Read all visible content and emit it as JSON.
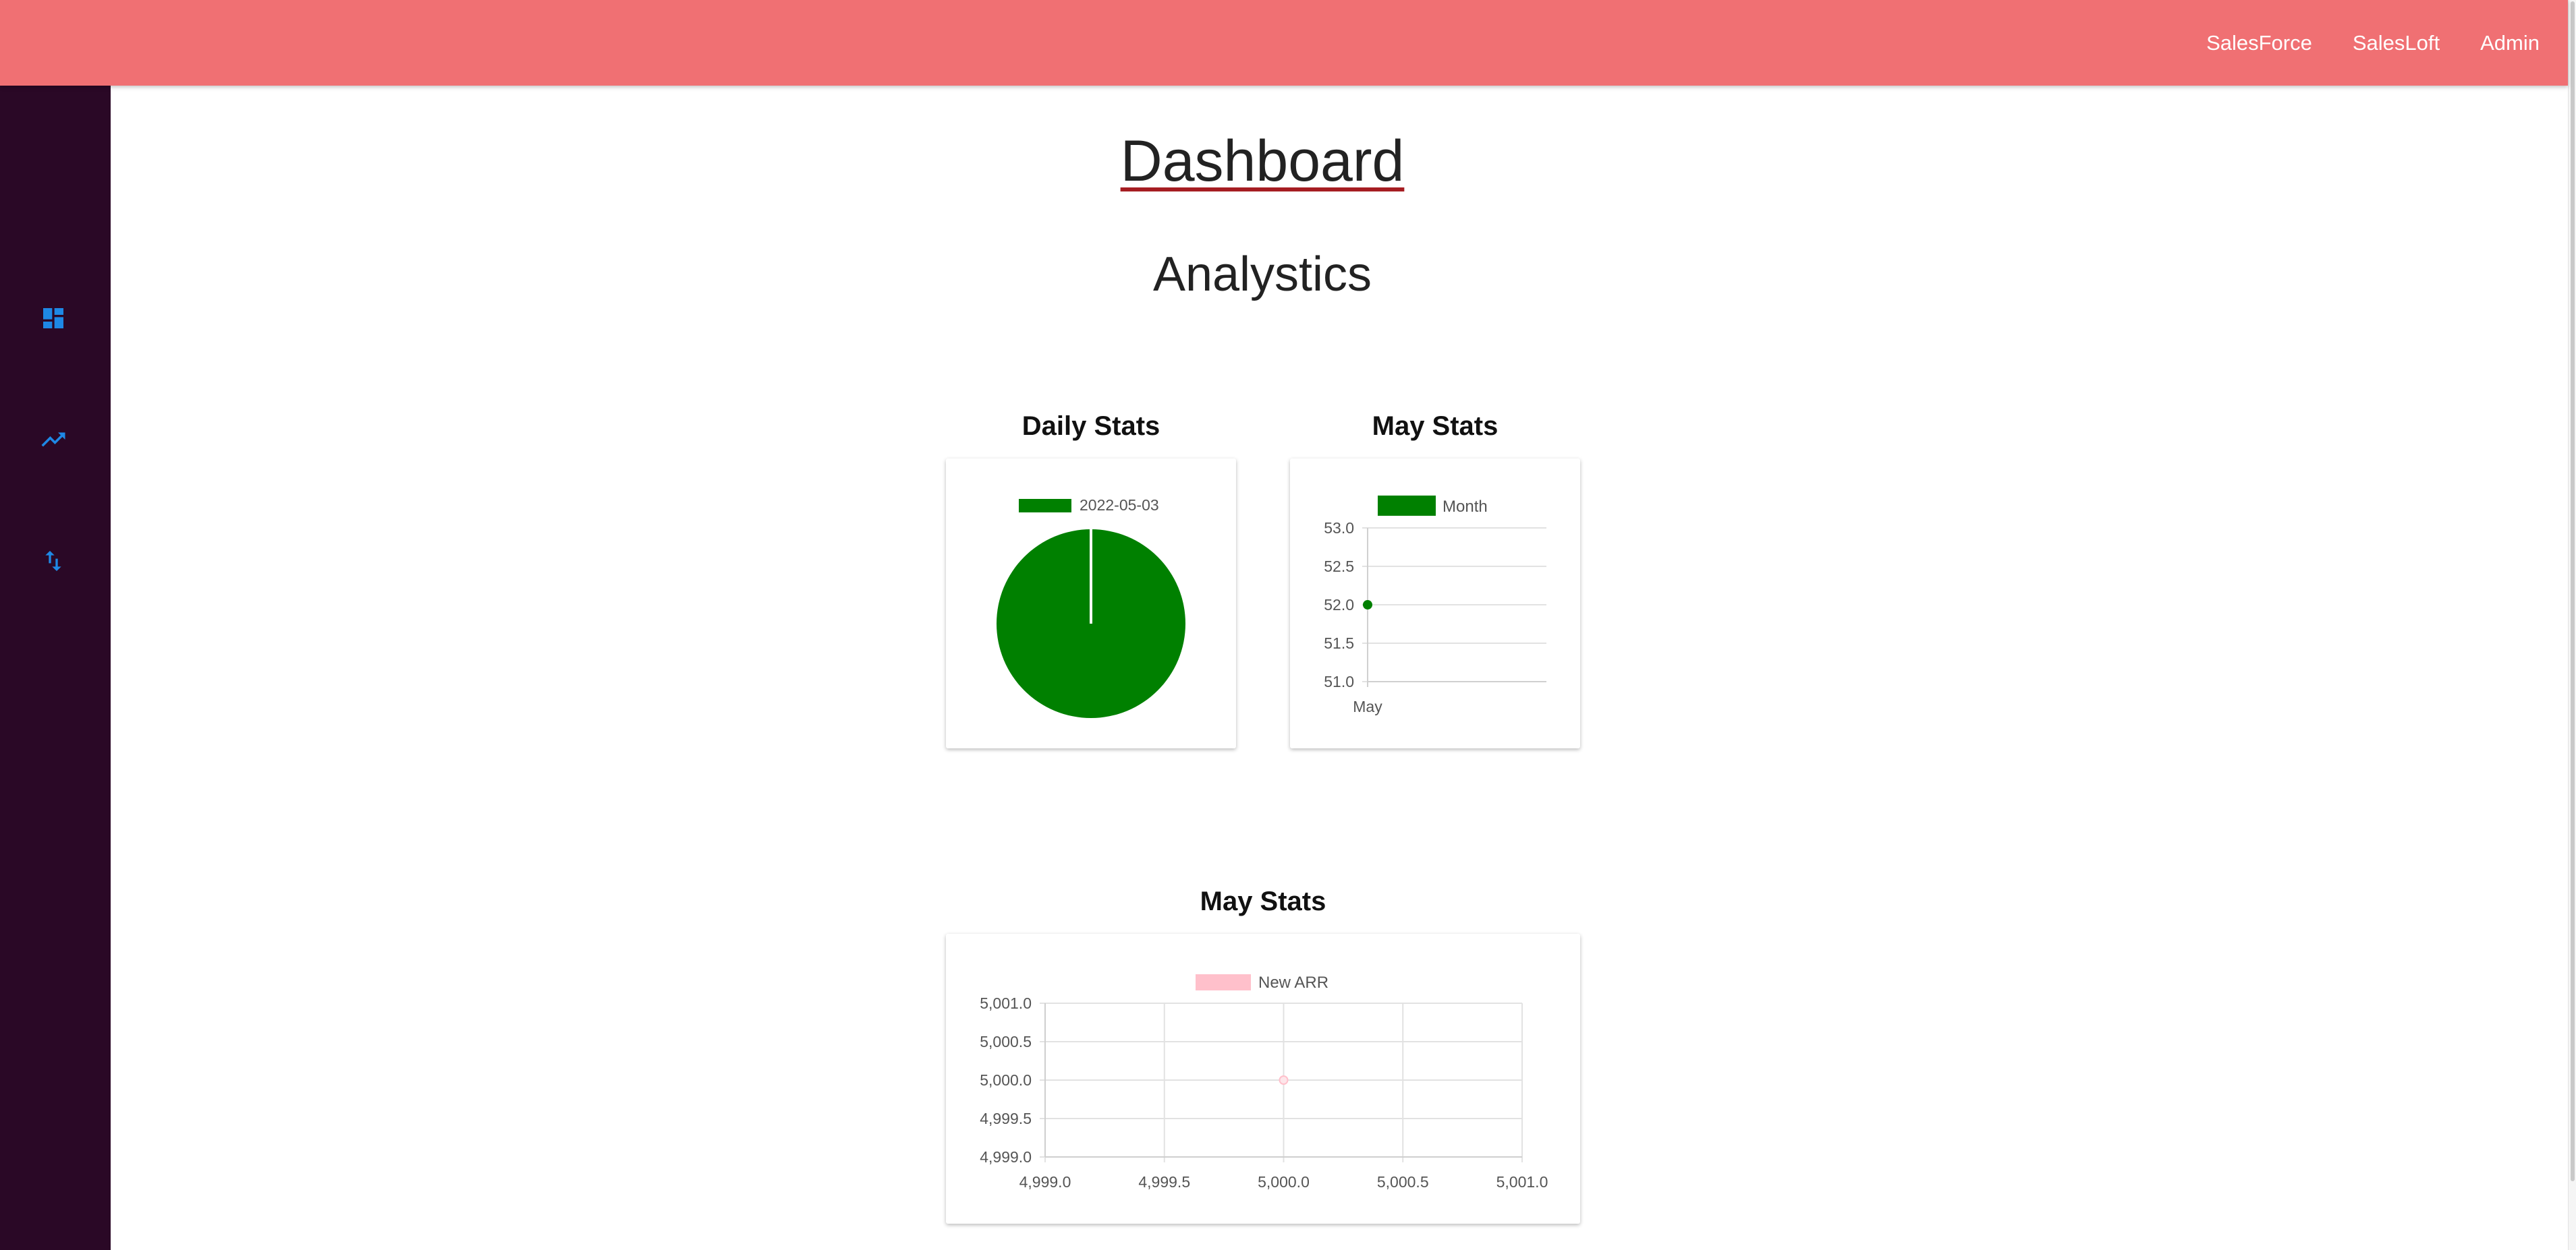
{
  "nav": {
    "links": [
      "SalesForce",
      "SalesLoft",
      "Admin"
    ]
  },
  "sidebar": {
    "icons": [
      "dashboard-icon",
      "trending-up-icon",
      "swap-vertical-icon"
    ],
    "icon_color": "#1e88e5"
  },
  "page": {
    "title": "Dashboard",
    "subtitle": "Analystics"
  },
  "colors": {
    "topbar": "#f07073",
    "sidebar": "#2a0826",
    "green": "#008000",
    "pink": "#ffc0cb"
  },
  "charts": {
    "daily": {
      "title": "Daily Stats"
    },
    "may": {
      "title": "May Stats"
    },
    "arr": {
      "title": "May Stats"
    }
  },
  "chart_data": [
    {
      "type": "pie",
      "title": "Daily Stats",
      "legend": [
        "2022-05-03"
      ],
      "labels": [
        "2022-05-03"
      ],
      "values": [
        1
      ],
      "colors": [
        "#008000"
      ],
      "legend_position": "top"
    },
    {
      "type": "line",
      "title": "May Stats",
      "categories": [
        "May"
      ],
      "series": [
        {
          "name": "Month",
          "values": [
            52
          ],
          "color": "#008000"
        }
      ],
      "yticks": [
        "53.0",
        "52.5",
        "52.0",
        "51.5",
        "51.0"
      ],
      "ylim": [
        51,
        53
      ],
      "grid": true,
      "legend_position": "top"
    },
    {
      "type": "scatter",
      "title": "May Stats",
      "series": [
        {
          "name": "New ARR",
          "points": [
            [
              5000,
              5000
            ]
          ],
          "color": "#ffc0cb"
        }
      ],
      "xticks": [
        "4,999.0",
        "4,999.5",
        "5,000.0",
        "5,000.5",
        "5,001.0"
      ],
      "yticks": [
        "5,001.0",
        "5,000.5",
        "5,000.0",
        "4,999.5",
        "4,999.0"
      ],
      "xlim": [
        4999,
        5001
      ],
      "ylim": [
        4999,
        5001
      ],
      "grid": true,
      "legend_position": "top"
    }
  ]
}
